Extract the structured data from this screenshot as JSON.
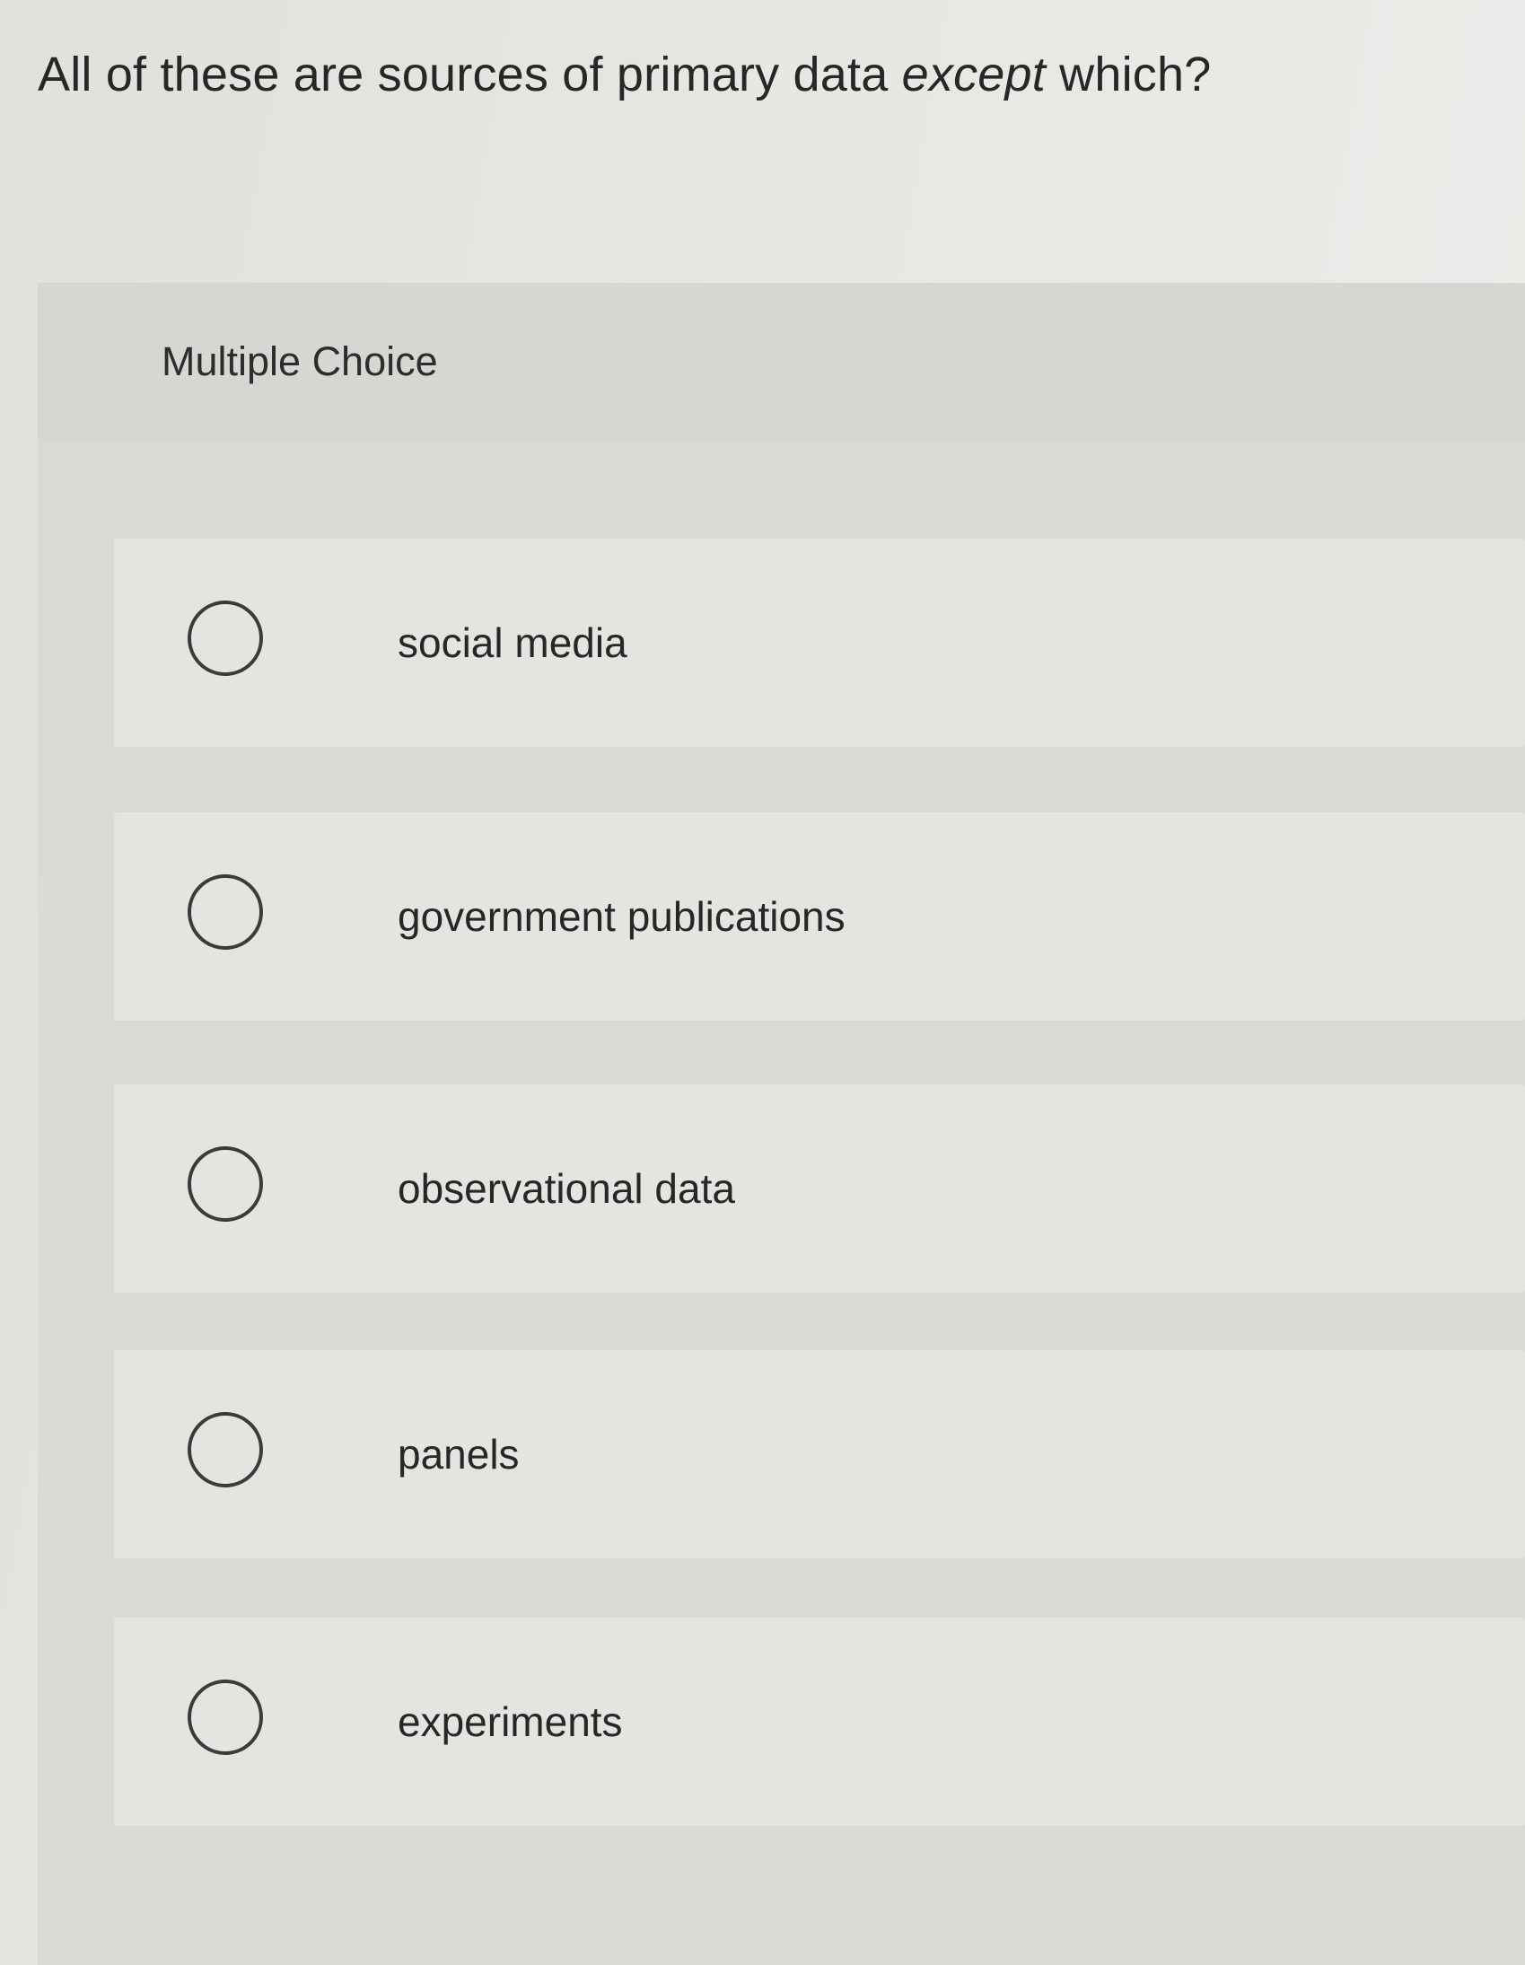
{
  "question": {
    "prefix": "All of these are sources of primary data ",
    "emphasis": "except",
    "suffix": " which?"
  },
  "panel": {
    "label": "Multiple Choice"
  },
  "options": [
    {
      "label": "social media"
    },
    {
      "label": "government publications"
    },
    {
      "label": "observational data"
    },
    {
      "label": "panels"
    },
    {
      "label": "experiments"
    }
  ]
}
